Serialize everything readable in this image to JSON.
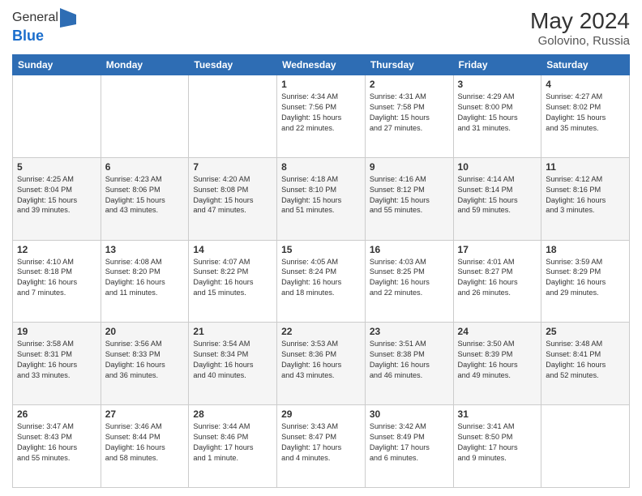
{
  "header": {
    "logo_general": "General",
    "logo_blue": "Blue",
    "month_year": "May 2024",
    "location": "Golovino, Russia"
  },
  "days_of_week": [
    "Sunday",
    "Monday",
    "Tuesday",
    "Wednesday",
    "Thursday",
    "Friday",
    "Saturday"
  ],
  "weeks": [
    [
      {
        "num": "",
        "info": ""
      },
      {
        "num": "",
        "info": ""
      },
      {
        "num": "",
        "info": ""
      },
      {
        "num": "1",
        "info": "Sunrise: 4:34 AM\nSunset: 7:56 PM\nDaylight: 15 hours\nand 22 minutes."
      },
      {
        "num": "2",
        "info": "Sunrise: 4:31 AM\nSunset: 7:58 PM\nDaylight: 15 hours\nand 27 minutes."
      },
      {
        "num": "3",
        "info": "Sunrise: 4:29 AM\nSunset: 8:00 PM\nDaylight: 15 hours\nand 31 minutes."
      },
      {
        "num": "4",
        "info": "Sunrise: 4:27 AM\nSunset: 8:02 PM\nDaylight: 15 hours\nand 35 minutes."
      }
    ],
    [
      {
        "num": "5",
        "info": "Sunrise: 4:25 AM\nSunset: 8:04 PM\nDaylight: 15 hours\nand 39 minutes."
      },
      {
        "num": "6",
        "info": "Sunrise: 4:23 AM\nSunset: 8:06 PM\nDaylight: 15 hours\nand 43 minutes."
      },
      {
        "num": "7",
        "info": "Sunrise: 4:20 AM\nSunset: 8:08 PM\nDaylight: 15 hours\nand 47 minutes."
      },
      {
        "num": "8",
        "info": "Sunrise: 4:18 AM\nSunset: 8:10 PM\nDaylight: 15 hours\nand 51 minutes."
      },
      {
        "num": "9",
        "info": "Sunrise: 4:16 AM\nSunset: 8:12 PM\nDaylight: 15 hours\nand 55 minutes."
      },
      {
        "num": "10",
        "info": "Sunrise: 4:14 AM\nSunset: 8:14 PM\nDaylight: 15 hours\nand 59 minutes."
      },
      {
        "num": "11",
        "info": "Sunrise: 4:12 AM\nSunset: 8:16 PM\nDaylight: 16 hours\nand 3 minutes."
      }
    ],
    [
      {
        "num": "12",
        "info": "Sunrise: 4:10 AM\nSunset: 8:18 PM\nDaylight: 16 hours\nand 7 minutes."
      },
      {
        "num": "13",
        "info": "Sunrise: 4:08 AM\nSunset: 8:20 PM\nDaylight: 16 hours\nand 11 minutes."
      },
      {
        "num": "14",
        "info": "Sunrise: 4:07 AM\nSunset: 8:22 PM\nDaylight: 16 hours\nand 15 minutes."
      },
      {
        "num": "15",
        "info": "Sunrise: 4:05 AM\nSunset: 8:24 PM\nDaylight: 16 hours\nand 18 minutes."
      },
      {
        "num": "16",
        "info": "Sunrise: 4:03 AM\nSunset: 8:25 PM\nDaylight: 16 hours\nand 22 minutes."
      },
      {
        "num": "17",
        "info": "Sunrise: 4:01 AM\nSunset: 8:27 PM\nDaylight: 16 hours\nand 26 minutes."
      },
      {
        "num": "18",
        "info": "Sunrise: 3:59 AM\nSunset: 8:29 PM\nDaylight: 16 hours\nand 29 minutes."
      }
    ],
    [
      {
        "num": "19",
        "info": "Sunrise: 3:58 AM\nSunset: 8:31 PM\nDaylight: 16 hours\nand 33 minutes."
      },
      {
        "num": "20",
        "info": "Sunrise: 3:56 AM\nSunset: 8:33 PM\nDaylight: 16 hours\nand 36 minutes."
      },
      {
        "num": "21",
        "info": "Sunrise: 3:54 AM\nSunset: 8:34 PM\nDaylight: 16 hours\nand 40 minutes."
      },
      {
        "num": "22",
        "info": "Sunrise: 3:53 AM\nSunset: 8:36 PM\nDaylight: 16 hours\nand 43 minutes."
      },
      {
        "num": "23",
        "info": "Sunrise: 3:51 AM\nSunset: 8:38 PM\nDaylight: 16 hours\nand 46 minutes."
      },
      {
        "num": "24",
        "info": "Sunrise: 3:50 AM\nSunset: 8:39 PM\nDaylight: 16 hours\nand 49 minutes."
      },
      {
        "num": "25",
        "info": "Sunrise: 3:48 AM\nSunset: 8:41 PM\nDaylight: 16 hours\nand 52 minutes."
      }
    ],
    [
      {
        "num": "26",
        "info": "Sunrise: 3:47 AM\nSunset: 8:43 PM\nDaylight: 16 hours\nand 55 minutes."
      },
      {
        "num": "27",
        "info": "Sunrise: 3:46 AM\nSunset: 8:44 PM\nDaylight: 16 hours\nand 58 minutes."
      },
      {
        "num": "28",
        "info": "Sunrise: 3:44 AM\nSunset: 8:46 PM\nDaylight: 17 hours\nand 1 minute."
      },
      {
        "num": "29",
        "info": "Sunrise: 3:43 AM\nSunset: 8:47 PM\nDaylight: 17 hours\nand 4 minutes."
      },
      {
        "num": "30",
        "info": "Sunrise: 3:42 AM\nSunset: 8:49 PM\nDaylight: 17 hours\nand 6 minutes."
      },
      {
        "num": "31",
        "info": "Sunrise: 3:41 AM\nSunset: 8:50 PM\nDaylight: 17 hours\nand 9 minutes."
      },
      {
        "num": "",
        "info": ""
      }
    ]
  ]
}
